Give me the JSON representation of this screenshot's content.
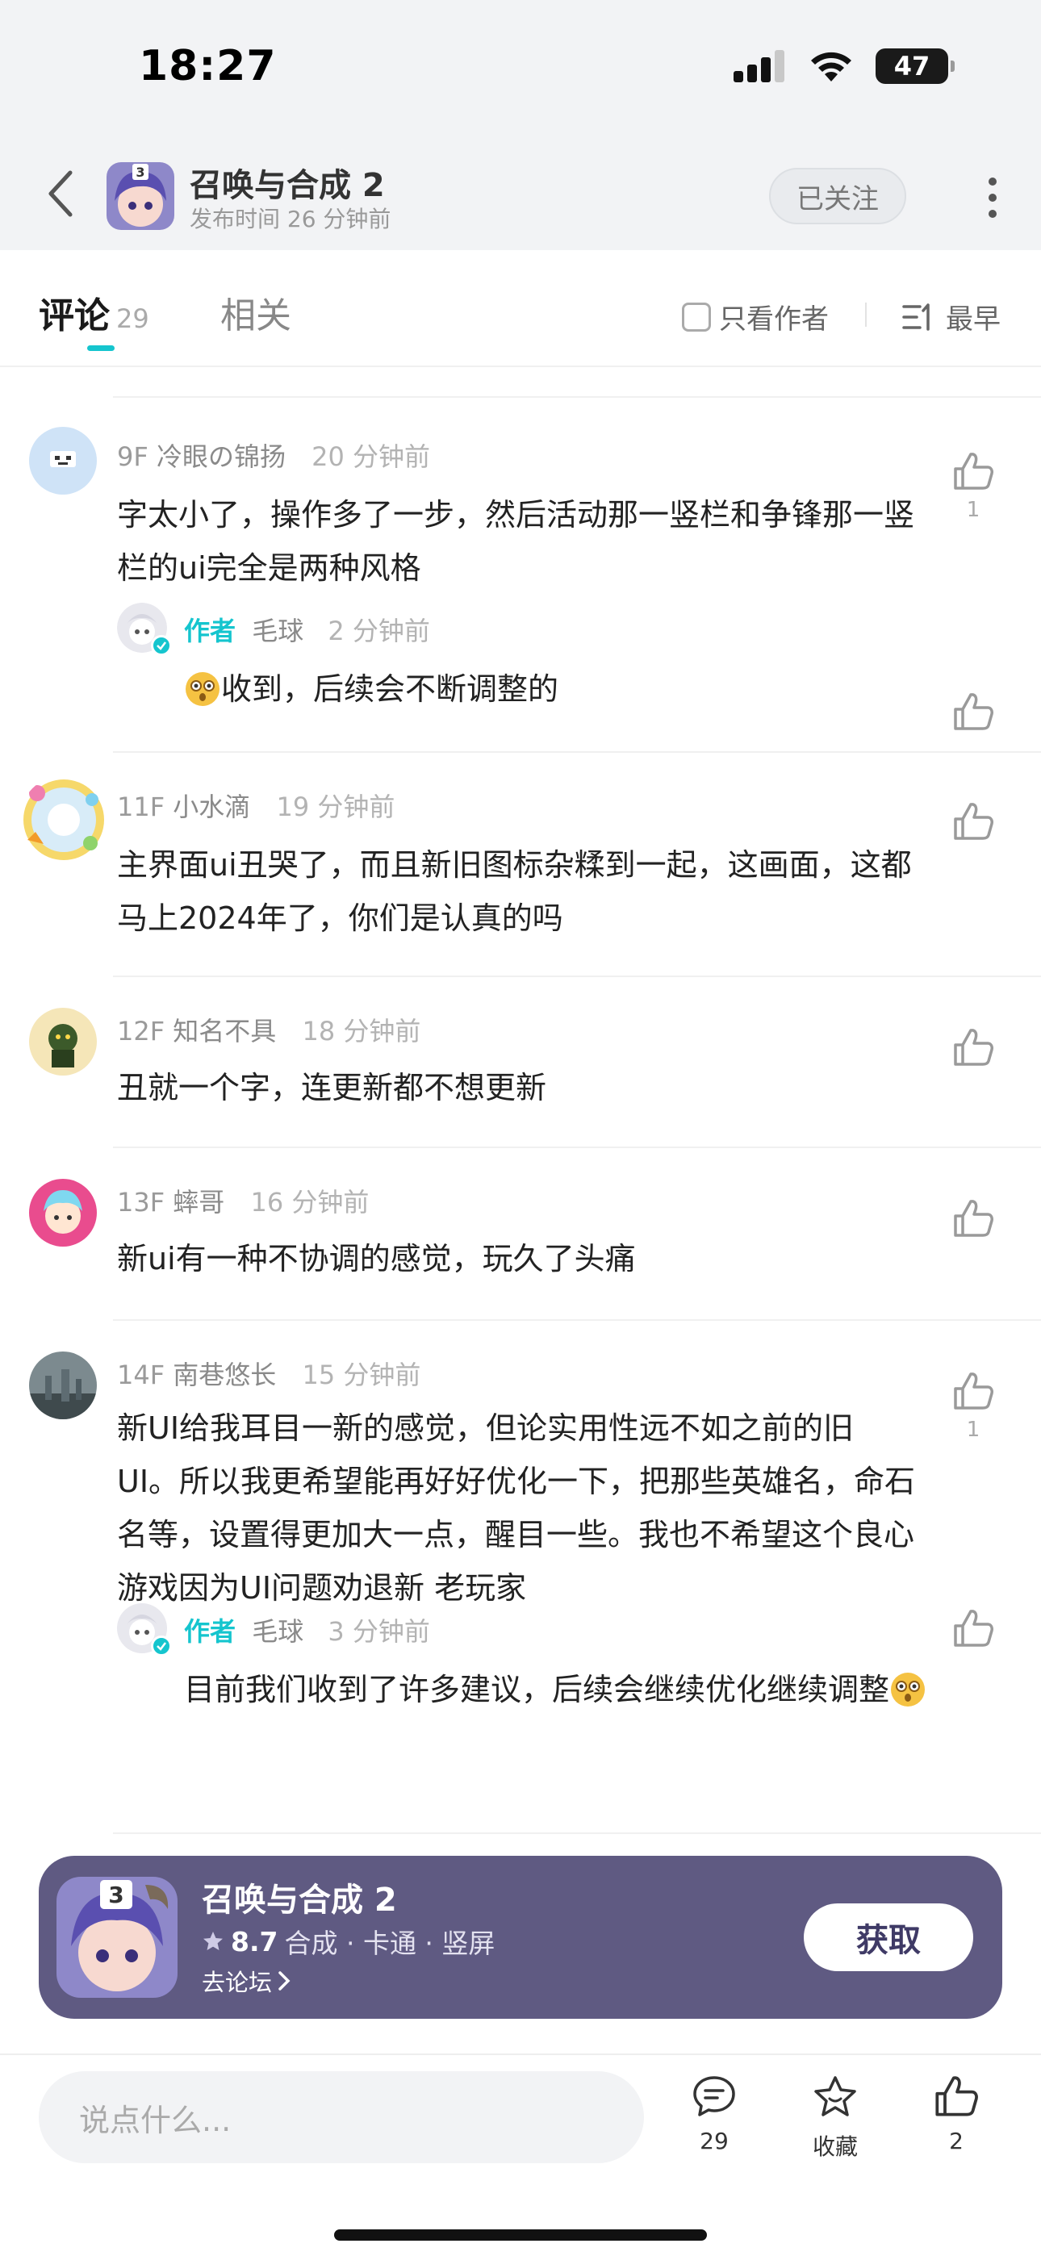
{
  "status_bar": {
    "time": "18:27",
    "battery": "47"
  },
  "header": {
    "title": "召唤与合成 2",
    "subtitle": "发布时间 26 分钟前",
    "follow_label": "已关注"
  },
  "tabs": {
    "comments_label": "评论",
    "comments_count": "29",
    "related_label": "相关",
    "author_only_label": "只看作者",
    "sort_label": "最早"
  },
  "comments": [
    {
      "floor": "9F",
      "name": "冷眼の锦扬",
      "time": "20 分钟前",
      "text": "字太小了，操作多了一步，然后活动那一竖栏和争锋那一竖栏的ui完全是两种风格",
      "likes": "1",
      "reply": {
        "author_tag": "作者",
        "name": "毛球",
        "time": "2 分钟前",
        "text": "收到，后续会不断调整的"
      }
    },
    {
      "floor": "11F",
      "name": "小水滴",
      "time": "19 分钟前",
      "text": "主界面ui丑哭了，而且新旧图标杂糅到一起，这画面，这都马上2024年了，你们是认真的吗",
      "likes": ""
    },
    {
      "floor": "12F",
      "name": "知名不具",
      "time": "18 分钟前",
      "text": "丑就一个字，连更新都不想更新",
      "likes": ""
    },
    {
      "floor": "13F",
      "name": "蟀哥",
      "time": "16 分钟前",
      "text": "新ui有一种不协调的感觉，玩久了头痛",
      "likes": ""
    },
    {
      "floor": "14F",
      "name": "南巷悠长",
      "time": "15 分钟前",
      "text": "新UI给我耳目一新的感觉，但论实用性远不如之前的旧UI。所以我更希望能再好好优化一下，把那些英雄名，命石名等，设置得更加大一点，醒目一些。我也不希望这个良心游戏因为UI问题劝退新 老玩家",
      "likes": "1",
      "reply": {
        "author_tag": "作者",
        "name": "毛球",
        "time": "3 分钟前",
        "text": "目前我们收到了许多建议，后续会继续优化继续调整"
      }
    }
  ],
  "promo": {
    "title": "召唤与合成 2",
    "score": "8.7",
    "tags": "合成 · 卡通 · 竖屏",
    "forum_label": "去论坛",
    "get_label": "获取"
  },
  "bottom_bar": {
    "input_placeholder": "说点什么...",
    "comment_count": "29",
    "collect_label": "收藏",
    "like_count": "2"
  },
  "colors": {
    "accent": "#15c5ce",
    "promo_bg": "#5f5a82"
  }
}
